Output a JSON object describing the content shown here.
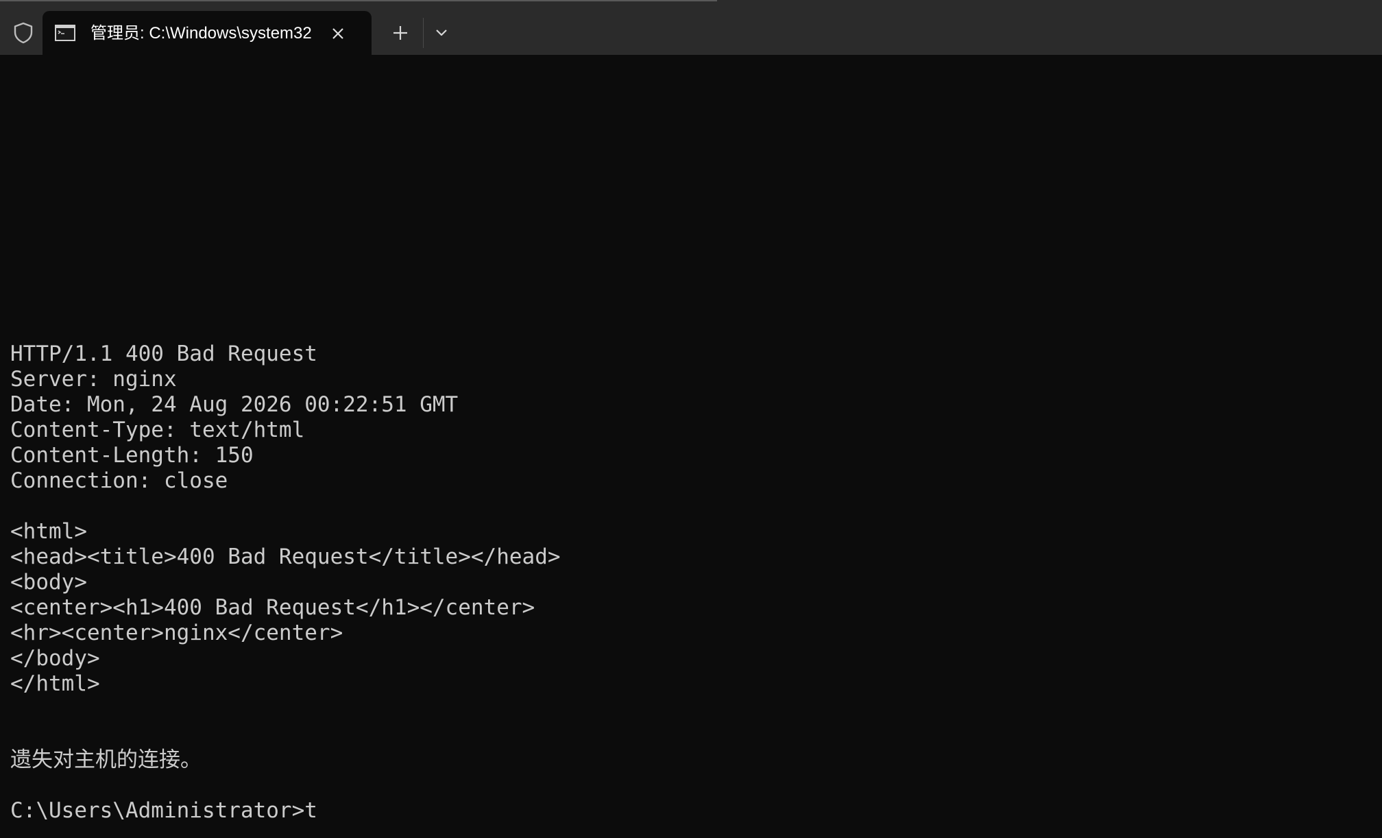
{
  "tabbar": {
    "tab": {
      "title": "管理员: C:\\Windows\\system32",
      "icon": "command-prompt-icon"
    },
    "icons": {
      "shield": "shield-icon",
      "close": "close-icon",
      "new_tab": "plus-icon",
      "dropdown": "chevron-down-icon"
    }
  },
  "terminal": {
    "lines": [
      "HTTP/1.1 400 Bad Request",
      "Server: nginx",
      "Date: Mon, 24 Aug 2026 00:22:51 GMT",
      "Content-Type: text/html",
      "Content-Length: 150",
      "Connection: close",
      "",
      "<html>",
      "<head><title>400 Bad Request</title></head>",
      "<body>",
      "<center><h1>400 Bad Request</h1></center>",
      "<hr><center>nginx</center>",
      "</body>",
      "</html>",
      "",
      "",
      "遗失对主机的连接。",
      "",
      "C:\\Users\\Administrator>t"
    ]
  },
  "colors": {
    "background": "#0c0c0c",
    "tabbar": "#2b2b2b",
    "text": "#cccccc"
  }
}
